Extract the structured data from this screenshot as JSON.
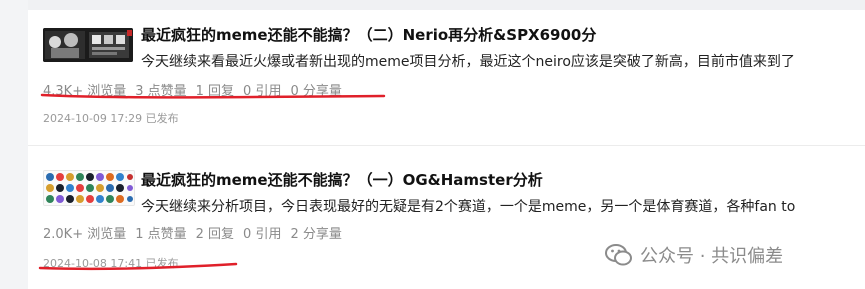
{
  "articles": [
    {
      "title": "最近疯狂的meme还能不能搞？（二）Nerio再分析&SPX6900分",
      "summary": "今天继续来看最近火爆或者新出现的meme项目分析，最近这个neiro应该是突破了新高，目前市值来到了",
      "stats": {
        "views": "4.3K+ 浏览量",
        "likes": "3 点赞量",
        "replies": "1 回复",
        "quotes": "0 引用",
        "shares": "0 分享量"
      },
      "date": "2024-10-09 17:29 已发布"
    },
    {
      "title": "最近疯狂的meme还能不能搞？（一）OG&Hamster分析",
      "summary": "今天继续来分析项目，今日表现最好的无疑是有2个赛道，一个是meme，另一个是体育赛道，各种fan to",
      "stats": {
        "views": "2.0K+ 浏览量",
        "likes": "1 点赞量",
        "replies": "2 回复",
        "quotes": "0 引用",
        "shares": "2 分享量"
      },
      "date": "2024-10-08 17:41 已发布"
    }
  ],
  "watermark": "公众号 · 共识偏差",
  "colors": {
    "annotation": "#e0202a",
    "muted": "#8a8a8a",
    "title": "#111111"
  }
}
